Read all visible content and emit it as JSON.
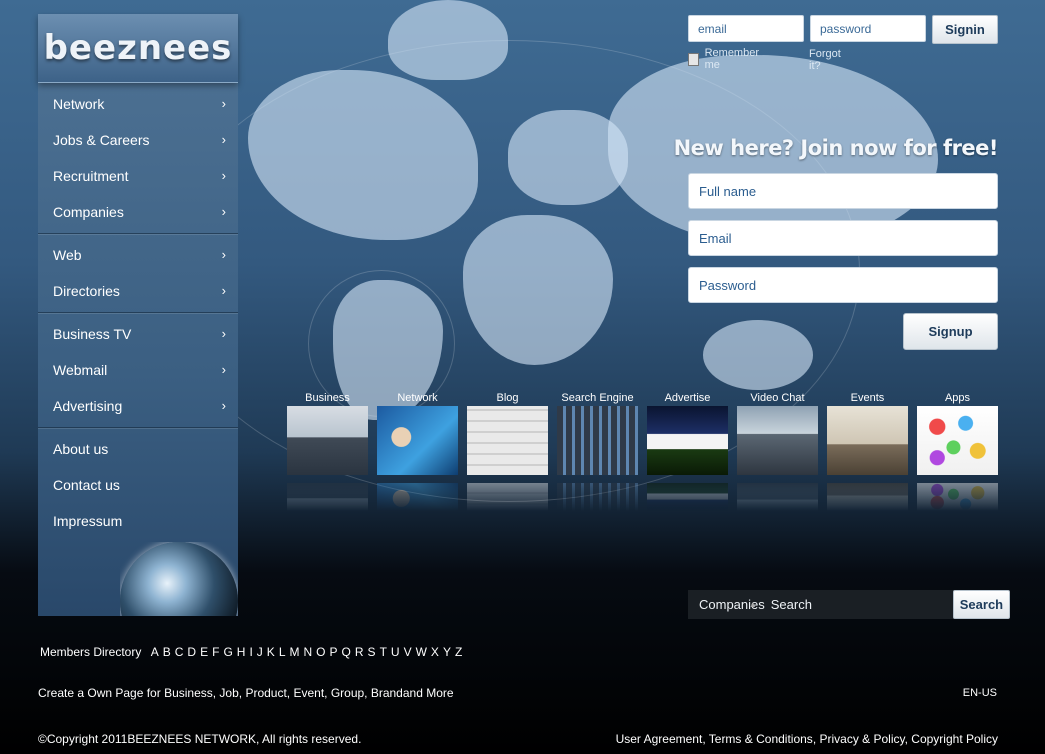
{
  "logo": "beeznees",
  "sidebar": {
    "groups": [
      {
        "items": [
          {
            "label": "Network",
            "name": "sidebar-item-network"
          },
          {
            "label": "Jobs & Careers",
            "name": "sidebar-item-jobs-careers"
          },
          {
            "label": "Recruitment",
            "name": "sidebar-item-recruitment"
          },
          {
            "label": "Companies",
            "name": "sidebar-item-companies"
          }
        ]
      },
      {
        "items": [
          {
            "label": "Web",
            "name": "sidebar-item-web"
          },
          {
            "label": "Directories",
            "name": "sidebar-item-directories"
          }
        ]
      },
      {
        "items": [
          {
            "label": "Business TV",
            "name": "sidebar-item-business-tv"
          },
          {
            "label": "Webmail",
            "name": "sidebar-item-webmail"
          },
          {
            "label": "Advertising",
            "name": "sidebar-item-advertising"
          }
        ]
      }
    ],
    "static_items": [
      {
        "label": "About us",
        "name": "sidebar-link-about-us"
      },
      {
        "label": "Contact us",
        "name": "sidebar-link-contact-us"
      },
      {
        "label": "Impressum",
        "name": "sidebar-link-impressum"
      }
    ],
    "arrow_icon": "›"
  },
  "login": {
    "email_placeholder": "email",
    "password_placeholder": "password",
    "signin_label": "Signin",
    "remember_label": "Remember me",
    "forgot_label": "Forgot it?"
  },
  "signup": {
    "title": "New here? Join now for free!",
    "fullname_placeholder": "Full name",
    "email_placeholder": "Email",
    "password_placeholder": "Password",
    "button_label": "Signup"
  },
  "tiles": [
    {
      "label": "Business",
      "name": "tile-business"
    },
    {
      "label": "Network",
      "name": "tile-network"
    },
    {
      "label": "Blog",
      "name": "tile-blog"
    },
    {
      "label": "Search Engine",
      "name": "tile-search-engine"
    },
    {
      "label": "Advertise",
      "name": "tile-advertise"
    },
    {
      "label": "Video Chat",
      "name": "tile-video-chat"
    },
    {
      "label": "Events",
      "name": "tile-events"
    },
    {
      "label": "Apps",
      "name": "tile-apps"
    }
  ],
  "search": {
    "category": "Companies",
    "placeholder": "Search",
    "button_label": "Search"
  },
  "footer": {
    "members_label": "Members Directory",
    "letters": [
      "A",
      "B",
      "C",
      "D",
      "E",
      "F",
      "G",
      "H",
      "I",
      "J",
      "K",
      "L",
      "M",
      "N",
      "O",
      "P",
      "Q",
      "R",
      "S",
      "T",
      "U",
      "V",
      "W",
      "X",
      "Y",
      "Z"
    ],
    "create_text": "Create a Own Page for Business, Job, Product, Event, Group, Brandand More",
    "lang": "EN-US",
    "copyright": "©Copyright 2011BEEZNEES NETWORK, All rights reserved.",
    "legal_links": [
      "User Agreement",
      "Terms & Conditions",
      "Privacy & Policy",
      "Copyright Policy"
    ]
  }
}
